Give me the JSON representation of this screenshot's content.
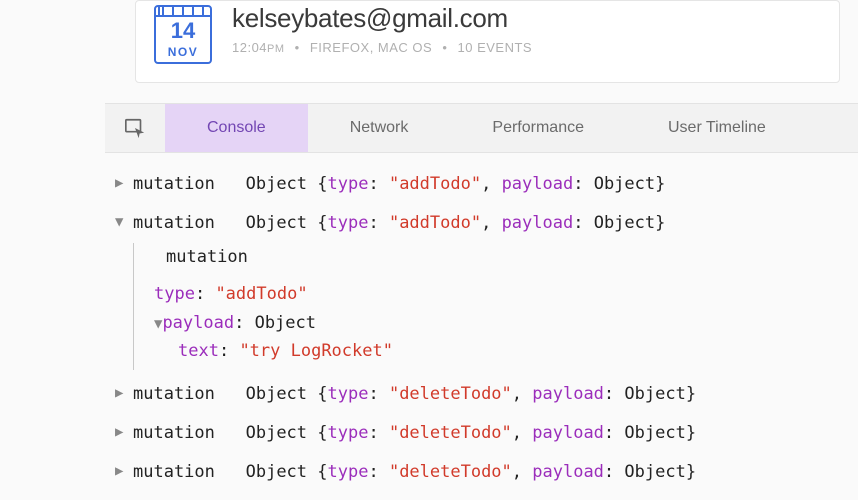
{
  "session": {
    "calendar": {
      "day": "14",
      "month": "NOV"
    },
    "email": "kelseybates@gmail.com",
    "time": "12:04",
    "time_suffix": "PM",
    "browser": "FIREFOX, MAC OS",
    "events": "10 EVENTS"
  },
  "tabs": {
    "console": "Console",
    "network": "Network",
    "performance": "Performance",
    "timeline": "User Timeline"
  },
  "log": {
    "label_mutation": "mutation",
    "label_object": "Object",
    "label_type": "type",
    "label_payload": "payload",
    "label_text": "text",
    "val_addTodo": "\"addTodo\"",
    "val_deleteTodo": "\"deleteTodo\"",
    "val_try": "\"try LogRocket\""
  }
}
